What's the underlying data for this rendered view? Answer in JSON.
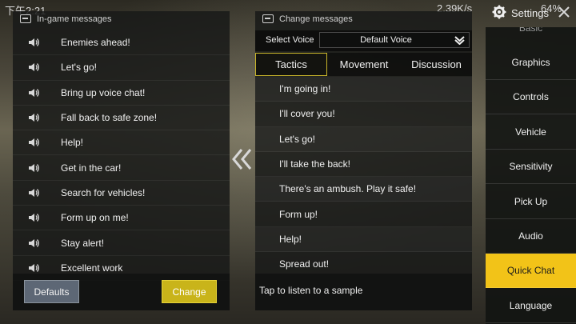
{
  "status_bar": {
    "time": "下午2:21",
    "speed": "2.39K/s",
    "battery": "64%"
  },
  "left_panel": {
    "title": "In-game messages",
    "messages": [
      "Enemies ahead!",
      "Let's go!",
      "Bring up voice chat!",
      "Fall back to safe zone!",
      "Help!",
      "Get in the car!",
      "Search for vehicles!",
      "Form up on me!",
      "Stay alert!",
      "Excellent work"
    ],
    "defaults_label": "Defaults",
    "change_label": "Change"
  },
  "right_panel": {
    "title": "Change messages",
    "select_voice_label": "Select Voice",
    "selected_voice": "Default Voice",
    "tabs": [
      {
        "label": "Tactics",
        "active": true
      },
      {
        "label": "Movement",
        "active": false
      },
      {
        "label": "Discussion",
        "active": false
      }
    ],
    "phrases": [
      "I'm going in!",
      "I'll cover you!",
      "Let's go!",
      "I'll take the back!",
      "There's an ambush. Play it safe!",
      "Form up!",
      "Help!",
      "Spread out!"
    ],
    "hint": "Tap to listen to a sample"
  },
  "settings": {
    "title": "Settings",
    "items": [
      {
        "label": "Basic",
        "active": false
      },
      {
        "label": "Graphics",
        "active": false
      },
      {
        "label": "Controls",
        "active": false
      },
      {
        "label": "Vehicle",
        "active": false
      },
      {
        "label": "Sensitivity",
        "active": false
      },
      {
        "label": "Pick Up",
        "active": false
      },
      {
        "label": "Audio",
        "active": false
      },
      {
        "label": "Quick Chat",
        "active": true
      },
      {
        "label": "Language",
        "active": false
      }
    ]
  },
  "colors": {
    "accent": "#f2c318",
    "change_button": "#c9b41a",
    "defaults_button": "#5d6775"
  },
  "icons": [
    "speaker-icon",
    "chat-icon",
    "edit-icon",
    "chevron-down-icon",
    "double-chevron-left-icon",
    "gear-icon",
    "close-icon"
  ]
}
